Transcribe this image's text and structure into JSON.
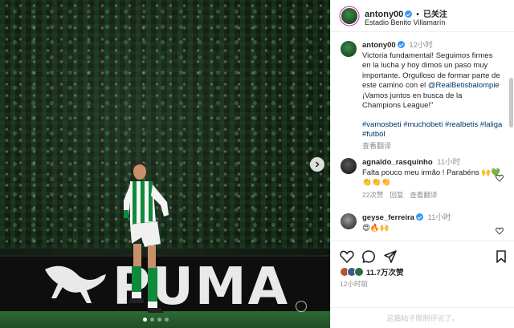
{
  "post": {
    "username": "antony00",
    "follow_status": "已关注",
    "separator": "•",
    "location": "Estadio Benito Villamarín",
    "image": {
      "board_text": "PUMA",
      "description_icons": [
        "puma-cat-logo",
        "player-figure"
      ]
    },
    "carousel": {
      "slide_count": 4,
      "active_index": 0
    }
  },
  "caption": {
    "username": "antony00",
    "time": "12小时",
    "text_before_mention": "Victoria fundamental! Seguimos firmes en la lucha y hoy dimos un paso muy importante. Orgulloso de formar parte de este camino con el ",
    "mention": "@RealBetisbalompie",
    "text_after_mention": " ¡Vamos juntos en busca de la Champions League!\"",
    "hashtags": "#vamosbeti #muchobeti #realbetis #laliga #futból",
    "translate": "查看翻译"
  },
  "comments": [
    {
      "username": "agnaldo_rasquinho",
      "time": "11小时",
      "text": "Falta pouco meu irmão ! Parabéns 🙌💚👏👏👏",
      "likes": "22次赞",
      "reply": "回复",
      "translate": "查看翻译"
    },
    {
      "username": "geyse_ferreira",
      "time": "11小时",
      "text": "😍🔥🙌",
      "likes": "",
      "reply": "",
      "translate": ""
    }
  ],
  "actions": {
    "likes_count": "11.7万次赞",
    "post_time": "12小时前",
    "comments_limited": "这篇帖子限制评论了。"
  },
  "colors": {
    "verified": "#3897f0",
    "link": "#00376b",
    "muted": "#8e8e8e",
    "betis_green": "#0f8a3c"
  }
}
